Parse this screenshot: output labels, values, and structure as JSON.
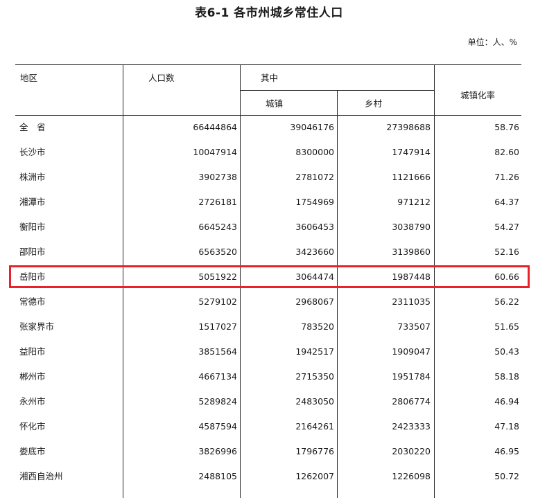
{
  "title": "表6-1 各市州城乡常住人口",
  "unit": "单位：人、%",
  "headers": {
    "region": "地区",
    "population": "人口数",
    "of_which": "其中",
    "urban": "城镇",
    "rural": "乡村",
    "urbanization_rate": "城镇化率"
  },
  "rows": [
    {
      "name": "全　省",
      "total": "66444864",
      "urban": "39046176",
      "rural": "27398688",
      "rate": "58.76"
    },
    {
      "name": "长沙市",
      "total": "10047914",
      "urban": "8300000",
      "rural": "1747914",
      "rate": "82.60"
    },
    {
      "name": "株洲市",
      "total": "3902738",
      "urban": "2781072",
      "rural": "1121666",
      "rate": "71.26"
    },
    {
      "name": "湘潭市",
      "total": "2726181",
      "urban": "1754969",
      "rural": "971212",
      "rate": "64.37"
    },
    {
      "name": "衡阳市",
      "total": "6645243",
      "urban": "3606453",
      "rural": "3038790",
      "rate": "54.27"
    },
    {
      "name": "邵阳市",
      "total": "6563520",
      "urban": "3423660",
      "rural": "3139860",
      "rate": "52.16"
    },
    {
      "name": "岳阳市",
      "total": "5051922",
      "urban": "3064474",
      "rural": "1987448",
      "rate": "60.66"
    },
    {
      "name": "常德市",
      "total": "5279102",
      "urban": "2968067",
      "rural": "2311035",
      "rate": "56.22"
    },
    {
      "name": "张家界市",
      "total": "1517027",
      "urban": "783520",
      "rural": "733507",
      "rate": "51.65"
    },
    {
      "name": "益阳市",
      "total": "3851564",
      "urban": "1942517",
      "rural": "1909047",
      "rate": "50.43"
    },
    {
      "name": "郴州市",
      "total": "4667134",
      "urban": "2715350",
      "rural": "1951784",
      "rate": "58.18"
    },
    {
      "name": "永州市",
      "total": "5289824",
      "urban": "2483050",
      "rural": "2806774",
      "rate": "46.94"
    },
    {
      "name": "怀化市",
      "total": "4587594",
      "urban": "2164261",
      "rural": "2423333",
      "rate": "47.18"
    },
    {
      "name": "娄底市",
      "total": "3826996",
      "urban": "1796776",
      "rural": "2030220",
      "rate": "46.95"
    },
    {
      "name": "湘西自治州",
      "total": "2488105",
      "urban": "1262007",
      "rural": "1226098",
      "rate": "50.72"
    }
  ],
  "highlight_color": "#e8212b"
}
